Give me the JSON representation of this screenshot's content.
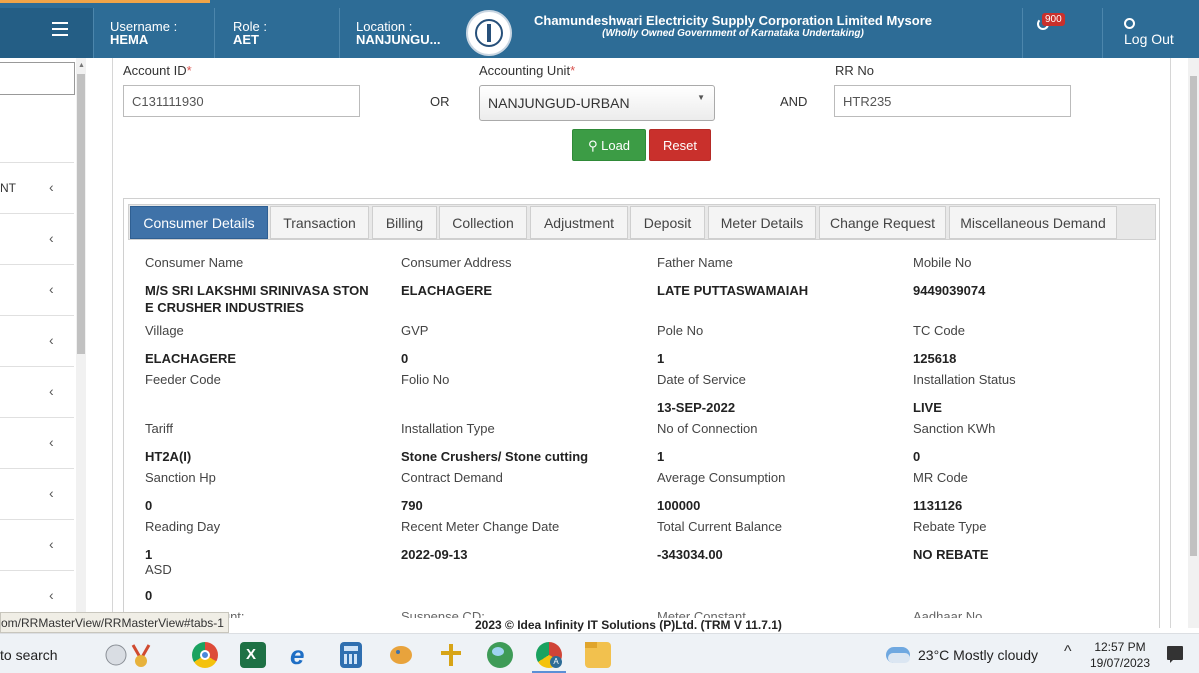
{
  "header": {
    "username_label": "Username :",
    "username_value": "HEMA",
    "role_label": "Role :",
    "role_value": "AET",
    "location_label": "Location :",
    "location_value": "NANJUNGU...",
    "corp_name": "Chamundeshwari Electricity Supply Corporation Limited Mysore",
    "corp_subtitle": "(Wholly Owned Government of Karnataka Undertaking)",
    "notification_count": "900",
    "logout_label": "Log Out"
  },
  "sidebar": {
    "items": [
      {
        "label": "NT"
      },
      {
        "label": ""
      },
      {
        "label": ""
      },
      {
        "label": ""
      },
      {
        "label": ""
      },
      {
        "label": ""
      },
      {
        "label": ""
      },
      {
        "label": ""
      },
      {
        "label": ""
      }
    ],
    "chevron": "‹"
  },
  "search_form": {
    "account_id_label": "Account ID",
    "account_id_value": "C131111930",
    "or_label": "OR",
    "accounting_unit_label": "Accounting Unit",
    "accounting_unit_value": "NANJUNGUD-URBAN",
    "and_label": "AND",
    "rr_no_label": "RR No",
    "rr_no_value": "HTR235",
    "required_marker": "*",
    "load_label": "Load",
    "reset_label": "Reset"
  },
  "tabs": [
    {
      "label": "Consumer Details",
      "active": true
    },
    {
      "label": "Transaction"
    },
    {
      "label": "Billing"
    },
    {
      "label": "Collection"
    },
    {
      "label": "Adjustment"
    },
    {
      "label": "Deposit"
    },
    {
      "label": "Meter Details"
    },
    {
      "label": "Change Request"
    },
    {
      "label": "Miscellaneous Demand"
    }
  ],
  "consumer_details": {
    "consumer_name_label": "Consumer Name",
    "consumer_name": "M/S SRI LAKSHMI SRINIVASA STON E CRUSHER INDUSTRIES",
    "consumer_address_label": "Consumer Address",
    "consumer_address": "ELACHAGERE",
    "father_name_label": "Father Name",
    "father_name": "LATE PUTTASWAMAIAH",
    "mobile_no_label": "Mobile No",
    "mobile_no": "9449039074",
    "village_label": "Village",
    "village": "ELACHAGERE",
    "gvp_label": "GVP",
    "gvp": "0",
    "pole_no_label": "Pole No",
    "pole_no": "1",
    "tc_code_label": "TC Code",
    "tc_code": "125618",
    "feeder_code_label": "Feeder Code",
    "feeder_code": "",
    "folio_no_label": "Folio No",
    "folio_no": "",
    "date_of_service_label": "Date of Service",
    "date_of_service": "13-SEP-2022",
    "installation_status_label": "Installation Status",
    "installation_status": "LIVE",
    "tariff_label": "Tariff",
    "tariff": "HT2A(I)",
    "installation_type_label": "Installation Type",
    "installation_type": "Stone Crushers/ Stone cutting",
    "no_of_connection_label": "No of Connection",
    "no_of_connection": "1",
    "sanction_kwh_label": "Sanction KWh",
    "sanction_kwh": "0",
    "sanction_hp_label": "Sanction Hp",
    "sanction_hp": "0",
    "contract_demand_label": "Contract Demand",
    "contract_demand": "790",
    "average_consumption_label": "Average Consumption",
    "average_consumption": "100000",
    "mr_code_label": "MR Code",
    "mr_code": "1131126",
    "reading_day_label": "Reading Day",
    "reading_day": "1",
    "recent_meter_change_date_label": "Recent Meter Change Date",
    "recent_meter_change_date": "2022-09-13",
    "total_current_balance_label": "Total Current Balance",
    "total_current_balance": "-343034.00",
    "rebate_type_label": "Rebate Type",
    "rebate_type": "NO REBATE",
    "asd_label": "ASD",
    "asd": "0",
    "cut_row_labels": [
      "...unt:",
      "Suspense CD:",
      "Meter Constant",
      "Aadhaar No"
    ]
  },
  "footer": {
    "status_url": "om/RRMasterView/RRMasterView#tabs-1",
    "copyright": "2023 © Idea Infinity IT Solutions (P)Ltd. (TRM V 11.7.1)"
  },
  "taskbar": {
    "search_text": "to search",
    "weather": "23°C  Mostly cloudy",
    "time": "12:57 PM",
    "date": "19/07/2023",
    "caret": "^",
    "colors": {
      "chrome": "#dd4b39",
      "excel": "#1e7145",
      "edge": "#1f6fc5",
      "calculator": "#2f6fb0",
      "paint": "#e8a33c",
      "app": "#d7a417",
      "maps": "#3e9b57",
      "chrome_profile": "#d04437",
      "explorer": "#f2c14e"
    }
  }
}
